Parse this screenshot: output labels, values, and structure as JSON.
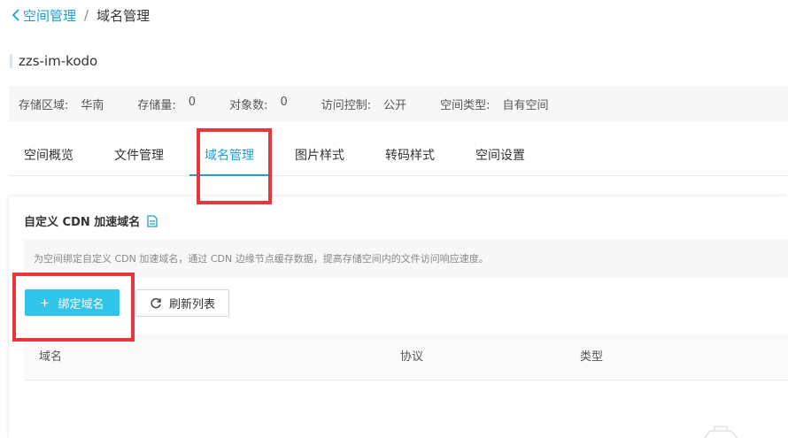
{
  "breadcrumb": {
    "back_label": "空间管理",
    "separator": "/",
    "current": "域名管理"
  },
  "bucket": {
    "name": "zzs-im-kodo"
  },
  "info": [
    {
      "label": "存储区域:",
      "value": "华南"
    },
    {
      "label": "存储量:",
      "value": "0"
    },
    {
      "label": "对象数:",
      "value": "0"
    },
    {
      "label": "访问控制:",
      "value": "公开"
    },
    {
      "label": "空间类型:",
      "value": "自有空间"
    }
  ],
  "tabs": [
    {
      "label": "空间概览"
    },
    {
      "label": "文件管理"
    },
    {
      "label": "域名管理"
    },
    {
      "label": "图片样式"
    },
    {
      "label": "转码样式"
    },
    {
      "label": "空间设置"
    }
  ],
  "active_tab": "域名管理",
  "panel": {
    "title": "自定义 CDN 加速域名",
    "description": "为空间绑定自定义 CDN 加速域名，通过 CDN 边缘节点缓存数据，提高存储空间内的文件访问响应速度。",
    "bind_button": "绑定域名",
    "refresh_button": "刷新列表",
    "columns": [
      "域名",
      "协议",
      "类型"
    ]
  },
  "colors": {
    "accent": "#1a9fd8",
    "primary_button": "#31c4ea",
    "highlight": "#e8373c"
  },
  "icons": {
    "back": "chevron-left-icon",
    "doc": "document-icon",
    "plus": "plus-icon",
    "refresh": "refresh-icon"
  }
}
